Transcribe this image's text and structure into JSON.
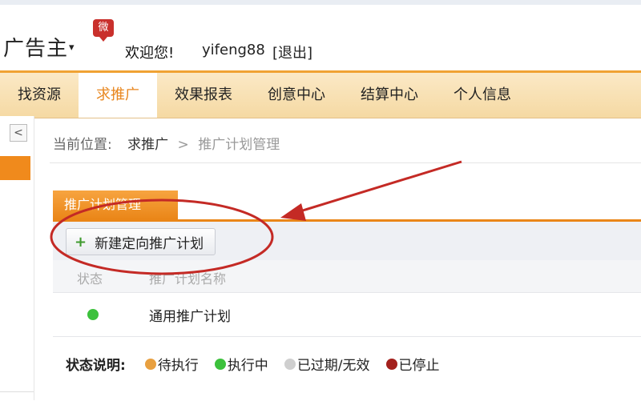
{
  "header": {
    "brand": "广告主",
    "brand_badge": "微",
    "welcome": "欢迎您!",
    "username": "yifeng88",
    "logout": "[退出]"
  },
  "nav": {
    "items": [
      {
        "label": "找资源"
      },
      {
        "label": "求推广",
        "active": true
      },
      {
        "label": "效果报表"
      },
      {
        "label": "创意中心"
      },
      {
        "label": "结算中心"
      },
      {
        "label": "个人信息"
      }
    ]
  },
  "sidebar": {
    "collapse_icon": "chevron-left-icon",
    "collapse_label": "<"
  },
  "breadcrumb": {
    "prefix": "当前位置:",
    "current": "求推广",
    "separator": ">",
    "page": "推广计划管理"
  },
  "panel": {
    "tab_label": "推广计划管理",
    "new_button": "新建定向推广计划",
    "new_button_icon": "plus-icon"
  },
  "table": {
    "headers": [
      "状态",
      "推广计划名称"
    ],
    "rows": [
      {
        "status": "执行中",
        "status_color": "#3cc13c",
        "name": "通用推广计划"
      }
    ]
  },
  "legend": {
    "title": "状态说明:",
    "items": [
      {
        "label": "待执行",
        "color": "#e8a040"
      },
      {
        "label": "执行中",
        "color": "#3cc13c"
      },
      {
        "label": "已过期/无效",
        "color": "#cfcfcf"
      },
      {
        "label": "已停止",
        "color": "#a3201c"
      }
    ]
  },
  "colors": {
    "accent": "#ea8618",
    "nav_bg": "#f5d9a3",
    "annotation": "#c42a25"
  }
}
